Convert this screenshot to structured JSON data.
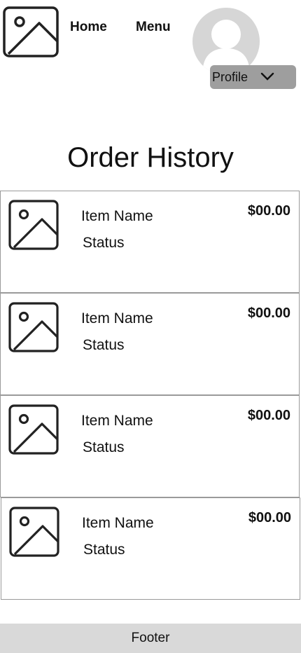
{
  "header": {
    "logo_icon": "image-placeholder-icon",
    "nav": [
      {
        "label": "Home"
      },
      {
        "label": "Menu"
      }
    ],
    "avatar_icon": "user-avatar-icon",
    "profile": {
      "label": "Profile",
      "icon": "chevron-down-icon"
    }
  },
  "main": {
    "title": "Order History",
    "orders": [
      {
        "name": "Item Name",
        "status": "Status",
        "price": "$00.00",
        "icon": "image-placeholder-icon"
      },
      {
        "name": "Item Name",
        "status": "Status",
        "price": "$00.00",
        "icon": "image-placeholder-icon"
      },
      {
        "name": "Item Name",
        "status": "Status",
        "price": "$00.00",
        "icon": "image-placeholder-icon"
      },
      {
        "name": "Item Name",
        "status": "Status",
        "price": "$00.00",
        "icon": "image-placeholder-icon"
      }
    ]
  },
  "footer": {
    "label": "Footer"
  },
  "colors": {
    "avatar_bg": "#d6d6d6",
    "profile_bg": "#9e9e9e",
    "footer_bg": "#d9d9d9",
    "card_border": "#9a9a9a"
  }
}
